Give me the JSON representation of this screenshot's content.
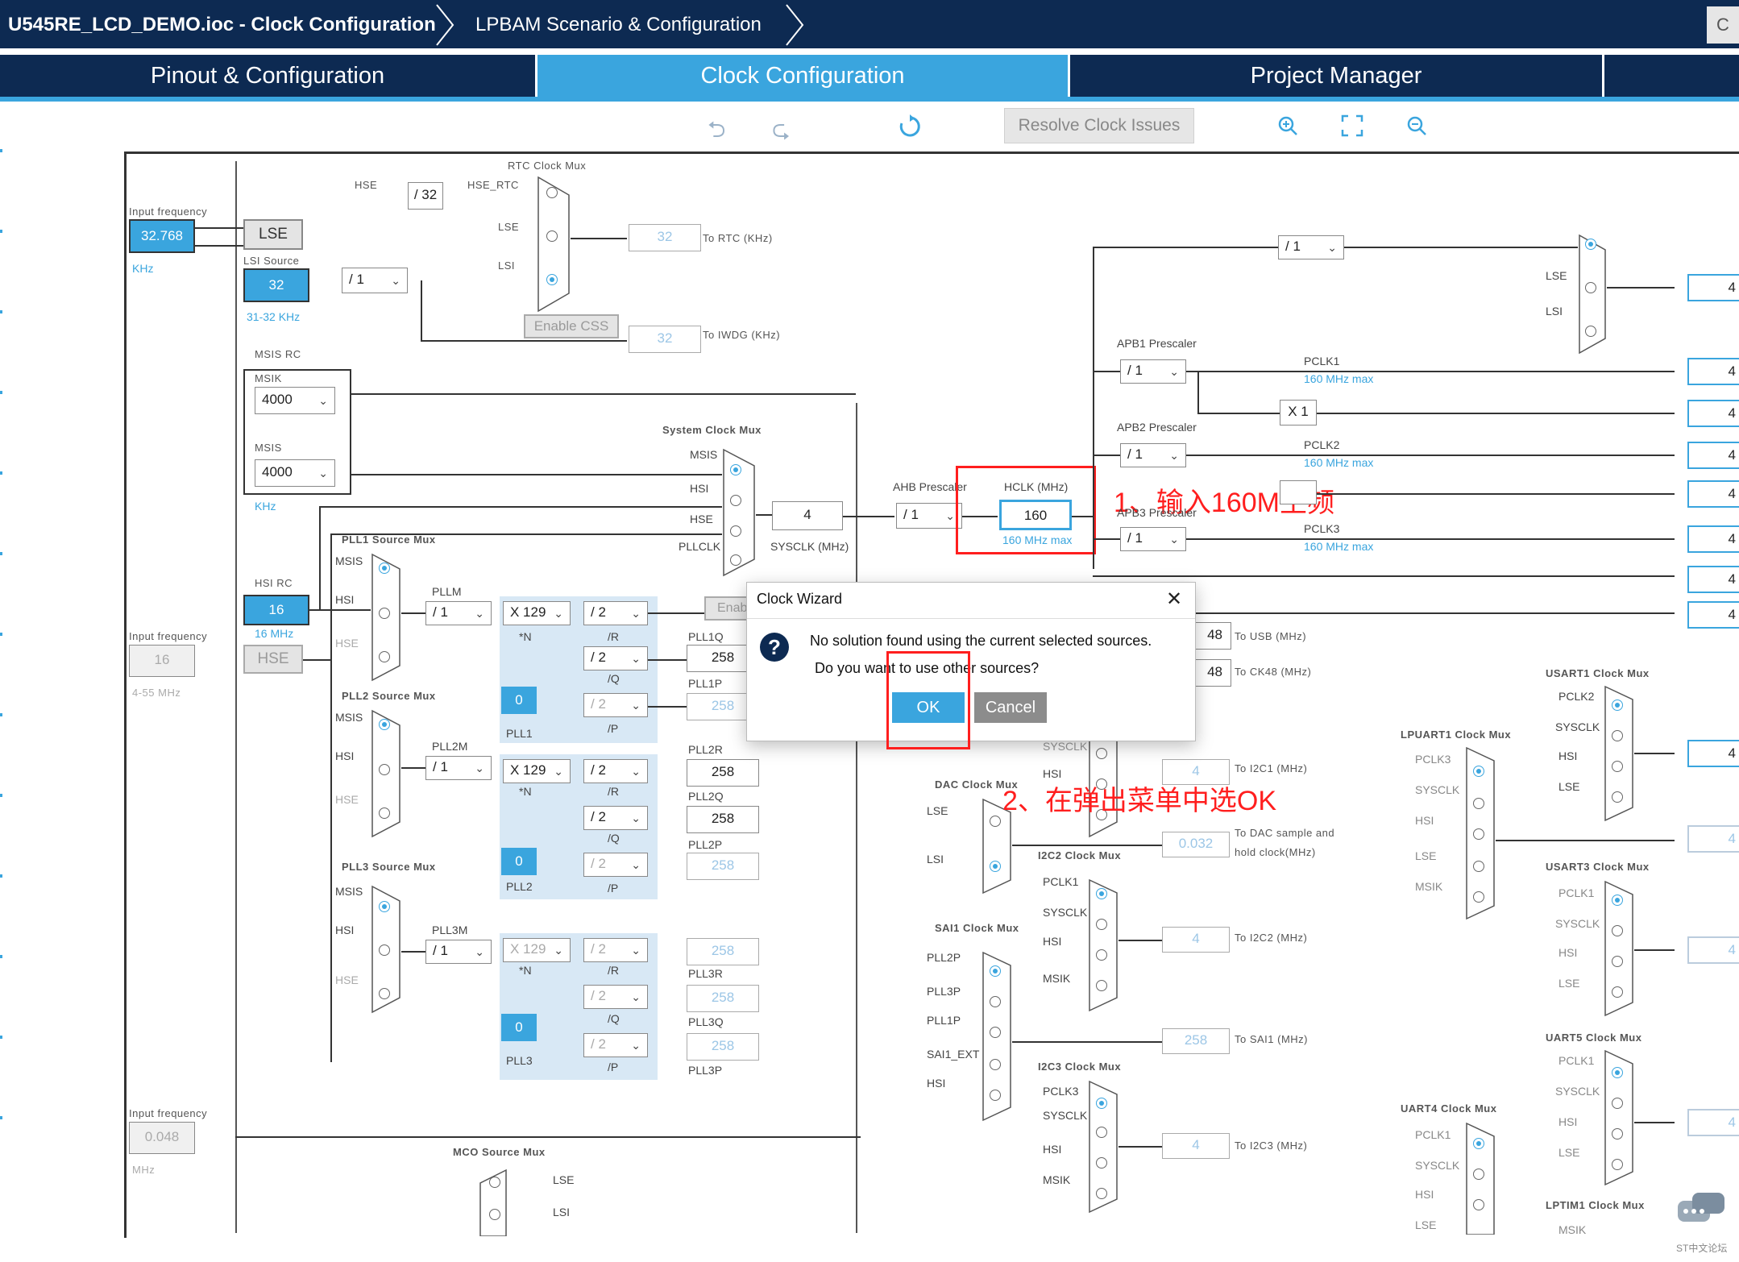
{
  "breadcrumb": {
    "file": "U545RE_LCD_DEMO.ioc - Clock Configuration",
    "scenario": "LPBAM Scenario & Configuration",
    "right_stub": "C"
  },
  "tabs": [
    {
      "label": "Pinout & Configuration",
      "active": false
    },
    {
      "label": "Clock Configuration",
      "active": true
    },
    {
      "label": "Project Manager",
      "active": false
    }
  ],
  "toolbar": {
    "undo_icon": "undo-icon",
    "redo_icon": "redo-icon",
    "refresh_icon": "refresh-icon",
    "resolve_label": "Resolve Clock Issues",
    "zoom_in_icon": "zoom-in-icon",
    "fit_icon": "fit-icon",
    "zoom_out_icon": "zoom-out-icon"
  },
  "lse": {
    "input_freq_label": "Input frequency",
    "value": "32.768",
    "unit": "KHz",
    "button": "LSE"
  },
  "lsi": {
    "source_label": "LSI Source",
    "value": "32",
    "range": "31-32 KHz",
    "div": "/ 1"
  },
  "rtc": {
    "mux_title": "RTC Clock Mux",
    "hse_label": "HSE",
    "hse_div": "/ 32",
    "hse_rtc": "HSE_RTC",
    "lse": "LSE",
    "lsi": "LSI",
    "out_value": "32",
    "out_label": "To RTC (KHz)",
    "enable_css": "Enable CSS",
    "iwdg_value": "32",
    "iwdg_label": "To IWDG (KHz)"
  },
  "msis": {
    "title": "MSIS RC",
    "msik_label": "MSIK",
    "msik_value": "4000",
    "msis_label": "MSIS",
    "msis_value": "4000",
    "unit": "KHz"
  },
  "sysmux": {
    "title": "System Clock Mux",
    "in1": "MSIS",
    "in2": "HSI",
    "in3": "HSE",
    "in4": "PLLCLK",
    "sysclk_value": "4",
    "sysclk_label": "SYSCLK (MHz)",
    "enable_stub": "Enab"
  },
  "ahb": {
    "label": "AHB Prescaler",
    "value": "/ 1",
    "hclk_label": "HCLK (MHz)",
    "hclk_value": "160",
    "hclk_max": "160 MHz max"
  },
  "apb": {
    "apb1_label": "APB1 Prescaler",
    "apb1_value": "/ 1",
    "pclk1": "PCLK1",
    "pclk1_max": "160 MHz max",
    "x1": "X 1",
    "apb2_label": "APB2 Prescaler",
    "apb2_value": "/ 1",
    "pclk2": "PCLK2",
    "pclk2_max": "160 MHz max",
    "apb3_label": "APB3 Prescaler",
    "apb3_value": "/ 1",
    "pclk3": "PCLK3",
    "pclk3_max": "160 MHz max",
    "top_div": "/ 1",
    "lse": "LSE",
    "lsi": "LSI"
  },
  "right_outputs": [
    "4",
    "4",
    "4",
    "4",
    "4",
    "4",
    "4",
    "4",
    "4",
    "4",
    "4",
    "4"
  ],
  "hsi": {
    "title": "HSI RC",
    "value": "16",
    "hint": "16 MHz"
  },
  "hse": {
    "input_label": "Input frequency",
    "value": "16",
    "button": "HSE",
    "range": "4-55 MHz"
  },
  "pll1": {
    "source_title": "PLL1 Source Mux",
    "in_msis": "MSIS",
    "in_hsi": "HSI",
    "in_hse": "HSE",
    "m_label": "PLLM",
    "m_value": "/ 1",
    "n_value": "X 129",
    "n_label": "*N",
    "r_value": "/ 2",
    "r_label": "/R",
    "q_value": "/ 2",
    "q_label": "/Q",
    "p_value": "/ 2",
    "p_label": "/P",
    "frac": "0",
    "name": "PLL1",
    "q_out_label": "PLL1Q",
    "q_out": "258",
    "p_out_label": "PLL1P",
    "p_out": "258"
  },
  "pll2": {
    "source_title": "PLL2 Source Mux",
    "in_msis": "MSIS",
    "in_hsi": "HSI",
    "in_hse": "HSE",
    "m_label": "PLL2M",
    "m_value": "/ 1",
    "n_value": "X 129",
    "n_label": "*N",
    "r_value": "/ 2",
    "r_label": "/R",
    "q_value": "/ 2",
    "q_label": "/Q",
    "p_value": "/ 2",
    "p_label": "/P",
    "frac": "0",
    "name": "PLL2",
    "r_out_label": "PLL2R",
    "r_out": "258",
    "q_out_label": "PLL2Q",
    "q_out": "258",
    "p_out_label": "PLL2P",
    "p_out": "258"
  },
  "pll3": {
    "source_title": "PLL3 Source Mux",
    "in_msis": "MSIS",
    "in_hsi": "HSI",
    "in_hse": "HSE",
    "m_label": "PLL3M",
    "m_value": "/ 1",
    "n_value": "X 129",
    "n_label": "*N",
    "r_value": "/ 2",
    "r_label": "/R",
    "q_value": "/ 2",
    "q_label": "/Q",
    "p_value": "/ 2",
    "p_label": "/P",
    "frac": "0",
    "name": "PLL3",
    "r_out": "258",
    "r_out_label": "PLL3R",
    "q_out": "258",
    "q_out_label": "PLL3Q",
    "p_out": "258",
    "p_out_label": "PLL3P"
  },
  "hsi48": {
    "input_label": "Input frequency",
    "value": "0.048",
    "unit": "MHz"
  },
  "mco": {
    "title": "MCO Source Mux",
    "lse": "LSE",
    "lsi": "LSI"
  },
  "periph": {
    "usb_value": "48",
    "usb_label": "To USB (MHz)",
    "ck48_value": "48",
    "ck48_label": "To CK48 (MHz)",
    "i2c1_sysclk": "SYSCLK",
    "i2c1_hsi": "HSI",
    "i2c1_value": "4",
    "i2c1_label": "To I2C1 (MHz)",
    "dac_title": "DAC Clock Mux",
    "dac_lse": "LSE",
    "dac_lsi": "LSI",
    "dac_value": "0.032",
    "dac_label1": "To DAC sample and",
    "dac_label2": "hold clock(MHz)",
    "i2c2_title": "I2C2 Clock Mux",
    "i2c2_pclk1": "PCLK1",
    "i2c2_sysclk": "SYSCLK",
    "i2c2_hsi": "HSI",
    "i2c2_msik": "MSIK",
    "i2c2_value": "4",
    "i2c2_label": "To I2C2 (MHz)",
    "sai1_title": "SAI1 Clock Mux",
    "sai1_in": [
      "PLL2P",
      "PLL3P",
      "PLL1P",
      "SAI1_EXT",
      "HSI"
    ],
    "sai1_value": "258",
    "sai1_label": "To SAI1 (MHz)",
    "i2c3_title": "I2C3 Clock Mux",
    "i2c3_pclk3": "PCLK3",
    "i2c3_sysclk": "SYSCLK",
    "i2c3_hsi": "HSI",
    "i2c3_msik": "MSIK",
    "i2c3_value": "4",
    "i2c3_label": "To I2C3 (MHz)",
    "lpuart1_title": "LPUART1 Clock Mux",
    "lpuart1_in": [
      "PCLK3",
      "SYSCLK",
      "HSI",
      "LSE",
      "MSIK"
    ],
    "uart4_title": "UART4 Clock Mux",
    "uart4_in": [
      "PCLK1",
      "SYSCLK",
      "HSI",
      "LSE"
    ],
    "usart1_title": "USART1 Clock Mux",
    "usart1_in": [
      "PCLK2",
      "SYSCLK",
      "HSI",
      "LSE"
    ],
    "usart3_title": "USART3 Clock Mux",
    "usart3_in": [
      "PCLK1",
      "SYSCLK",
      "HSI",
      "LSE"
    ],
    "uart5_title": "UART5 Clock Mux",
    "uart5_in": [
      "PCLK1",
      "SYSCLK",
      "HSI",
      "LSE"
    ],
    "lptim1_title": "LPTIM1 Clock Mux",
    "lptim1_in": [
      "MSIK"
    ]
  },
  "dialog": {
    "title": "Clock Wizard",
    "line1": "No solution found using the current selected sources.",
    "line2": "Do you want to use other sources?",
    "ok": "OK",
    "cancel": "Cancel"
  },
  "annotations": {
    "a1": "1、输入160M主频",
    "a2": "2、在弹出菜单中选OK"
  },
  "watermark": "ST中文论坛",
  "colors": {
    "navy": "#0d2a52",
    "accent": "#3aa5de",
    "annotation": "#ff1e1e"
  }
}
